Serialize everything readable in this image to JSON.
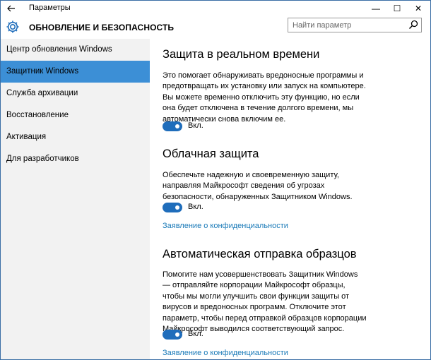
{
  "titlebar": {
    "back_icon": "arrow-left-icon",
    "title": "Параметры",
    "minimize": "—",
    "maximize": "☐",
    "close": "✕"
  },
  "header": {
    "icon": "gear-icon",
    "heading": "ОБНОВЛЕНИЕ И БЕЗОПАСНОСТЬ"
  },
  "search": {
    "placeholder": "Найти параметр",
    "value": "",
    "icon": "search-icon"
  },
  "sidebar": {
    "items": [
      {
        "label": "Центр обновления Windows",
        "selected": false
      },
      {
        "label": "Защитник Windows",
        "selected": true
      },
      {
        "label": "Служба архивации",
        "selected": false
      },
      {
        "label": "Восстановление",
        "selected": false
      },
      {
        "label": "Активация",
        "selected": false
      },
      {
        "label": "Для разработчиков",
        "selected": false
      }
    ]
  },
  "sections": [
    {
      "title": "Защита в реальном времени",
      "desc": "Это помогает обнаруживать вредоносные программы и предотвращать их установку или запуск на компьютере. Вы можете временно отключить эту функцию, но если она будет отключена в течение долгого времени, мы автоматически снова включим ее.",
      "toggle_label": "Вкл."
    },
    {
      "title": "Облачная защита",
      "desc": "Обеспечьте надежную и своевременную защиту, направляя Майкрософт сведения об угрозах безопасности, обнаруженных Защитником Windows.",
      "toggle_label": "Вкл.",
      "link": "Заявление о конфиденциальности"
    },
    {
      "title": "Автоматическая отправка образцов",
      "desc": "Помогите нам усовершенствовать Защитник Windows — отправляйте корпорации Майкрософт образцы, чтобы мы могли улучшить свои функции защиты от вирусов и вредоносных программ. Отключите этот параметр, чтобы перед отправкой образцов корпорации Майкрософт выводился соответствующий запрос.",
      "toggle_label": "Вкл.",
      "link": "Заявление о конфиденциальности"
    }
  ],
  "colors": {
    "accent": "#3c8fd6",
    "toggle_on": "#1f6dbb",
    "link": "#1a7ab8",
    "sidebar_bg": "#f2f2f2"
  }
}
